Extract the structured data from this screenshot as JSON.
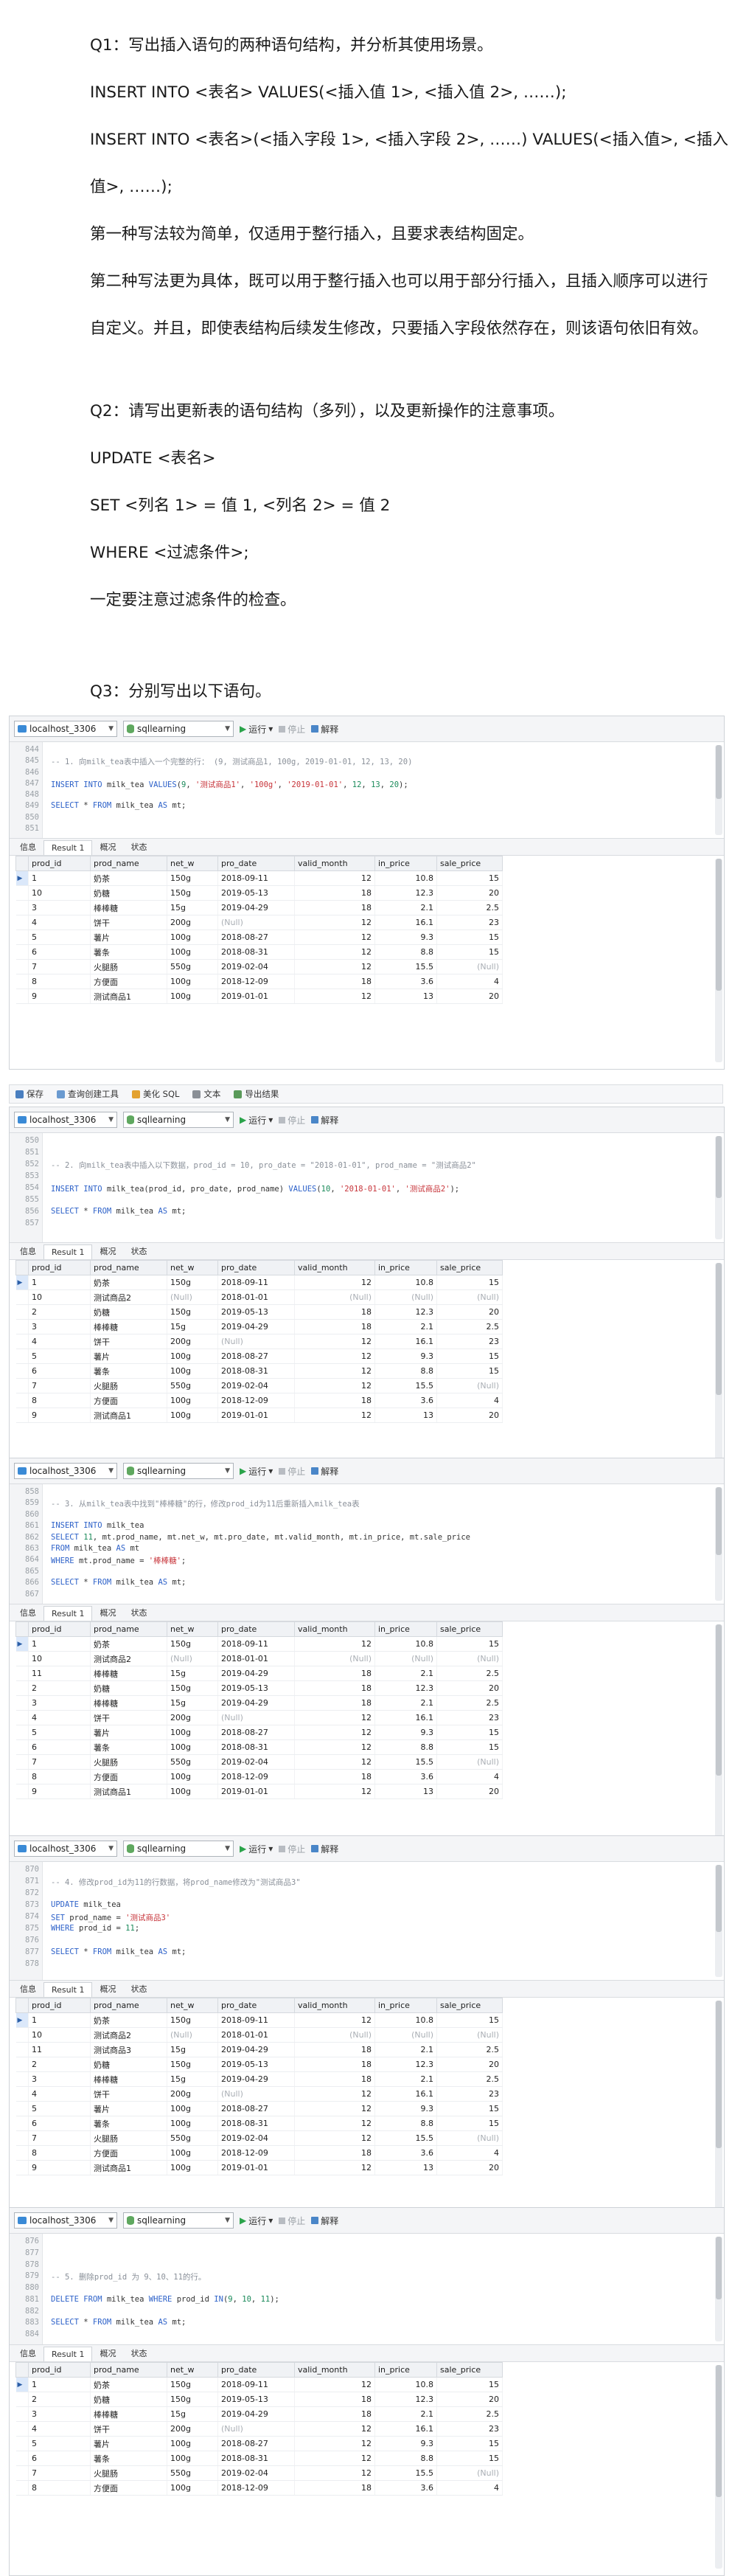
{
  "doc": {
    "q1_title": "Q1：写出插入语句的两种语句结构，并分析其使用场景。",
    "q1_syntax1": "INSERT INTO <表名> VALUES(<插入值 1>, <插入值 2>, ……);",
    "q1_syntax2a": "INSERT  INTO  <表名>(<插入字段  1>,  <插入字段  2>,  ……)  VALUES(<插入值>,  <插入",
    "q1_syntax2b": "值>, ……);",
    "q1_note1": "第一种写法较为简单，仅适用于整行插入，且要求表结构固定。",
    "q1_note2": "第二种写法更为具体，既可以用于整行插入也可以用于部分行插入，且插入顺序可以进行自定义。并且，即使表结构后续发生修改，只要插入字段依然存在，则该语句依旧有效。",
    "q2_title": "Q2：请写出更新表的语句结构（多列），以及更新操作的注意事项。",
    "q2_line1": "UPDATE <表名>",
    "q2_line2": "SET <列名 1> = 值 1, <列名 2> = 值 2",
    "q2_line3": "WHERE <过滤条件>;",
    "q2_note": "一定要注意过滤条件的检查。",
    "q3_title": "Q3：分别写出以下语句。"
  },
  "toolbar": {
    "connection": "localhost_3306",
    "database": "sqllearning",
    "run_label": "运行",
    "stop_label": "停止",
    "explain_label": "解释"
  },
  "main_toolbar": {
    "save": "保存",
    "query_builder": "查询创建工具",
    "beautify": "美化 SQL",
    "text": "文本",
    "export": "导出结果"
  },
  "result_tabs": [
    "信息",
    "Result 1",
    "概况",
    "状态"
  ],
  "columns": [
    "prod_id",
    "prod_name",
    "net_w",
    "pro_date",
    "valid_month",
    "in_price",
    "sale_price"
  ],
  "null_text": "(Null)",
  "shots": [
    {
      "line_numbers": [
        "844",
        "845",
        "846",
        "847",
        "848",
        "849",
        "850",
        "851"
      ],
      "code": [
        [],
        [
          {
            "t": "-- 1. 向milk_tea表中插入一个完整的行： (9, 测试商品1, 100g, 2019-01-01, 12, 13, 20)",
            "c": "cm"
          }
        ],
        [],
        [
          {
            "t": "INSERT INTO ",
            "c": "kw"
          },
          {
            "t": "milk_tea ",
            "c": ""
          },
          {
            "t": "VALUES",
            "c": "kw"
          },
          {
            "t": "(",
            "c": ""
          },
          {
            "t": "9",
            "c": "num"
          },
          {
            "t": ", ",
            "c": ""
          },
          {
            "t": "'测试商品1'",
            "c": "str"
          },
          {
            "t": ", ",
            "c": ""
          },
          {
            "t": "'100g'",
            "c": "str"
          },
          {
            "t": ", ",
            "c": ""
          },
          {
            "t": "'2019-01-01'",
            "c": "str"
          },
          {
            "t": ", ",
            "c": ""
          },
          {
            "t": "12",
            "c": "num"
          },
          {
            "t": ", ",
            "c": ""
          },
          {
            "t": "13",
            "c": "num"
          },
          {
            "t": ", ",
            "c": ""
          },
          {
            "t": "20",
            "c": "num"
          },
          {
            "t": ");",
            "c": ""
          }
        ],
        [],
        [
          {
            "t": "SELECT ",
            "c": "kw"
          },
          {
            "t": "* ",
            "c": ""
          },
          {
            "t": "FROM ",
            "c": "kw"
          },
          {
            "t": "milk_tea ",
            "c": ""
          },
          {
            "t": "AS ",
            "c": "kw"
          },
          {
            "t": "mt;",
            "c": ""
          }
        ],
        [],
        []
      ],
      "rows": [
        [
          "1",
          "奶茶",
          "150g",
          "2018-09-11",
          "12",
          "10.8",
          "15"
        ],
        [
          "10",
          "奶糖",
          "150g",
          "2019-05-13",
          "18",
          "12.3",
          "20"
        ],
        [
          "3",
          "棒棒糖",
          "15g",
          "2019-04-29",
          "18",
          "2.1",
          "2.5"
        ],
        [
          "4",
          "饼干",
          "200g",
          null,
          "12",
          "16.1",
          "23"
        ],
        [
          "5",
          "薯片",
          "100g",
          "2018-08-27",
          "12",
          "9.3",
          "15"
        ],
        [
          "6",
          "薯条",
          "100g",
          "2018-08-31",
          "12",
          "8.8",
          "15"
        ],
        [
          "7",
          "火腿肠",
          "550g",
          "2019-02-04",
          "12",
          "15.5",
          null
        ],
        [
          "8",
          "方便面",
          "100g",
          "2018-12-09",
          "18",
          "3.6",
          "4"
        ],
        [
          "9",
          "测试商品1",
          "100g",
          "2019-01-01",
          "12",
          "13",
          "20"
        ]
      ]
    },
    {
      "line_numbers": [
        "850",
        "851",
        "852",
        "853",
        "854",
        "855",
        "856",
        "857"
      ],
      "code": [
        [],
        [],
        [
          {
            "t": "-- 2. 向milk_tea表中插入以下数据，prod_id = 10, pro_date = \"2018-01-01\", prod_name = \"测试商品2\"",
            "c": "cm"
          }
        ],
        [],
        [
          {
            "t": "INSERT INTO ",
            "c": "kw"
          },
          {
            "t": "milk_tea(prod_id, pro_date, prod_name) ",
            "c": ""
          },
          {
            "t": "VALUES",
            "c": "kw"
          },
          {
            "t": "(",
            "c": ""
          },
          {
            "t": "10",
            "c": "num"
          },
          {
            "t": ", ",
            "c": ""
          },
          {
            "t": "'2018-01-01'",
            "c": "str"
          },
          {
            "t": ", ",
            "c": ""
          },
          {
            "t": "'测试商品2'",
            "c": "str"
          },
          {
            "t": ");",
            "c": ""
          }
        ],
        [],
        [
          {
            "t": "SELECT ",
            "c": "kw"
          },
          {
            "t": "* ",
            "c": ""
          },
          {
            "t": "FROM ",
            "c": "kw"
          },
          {
            "t": "milk_tea ",
            "c": ""
          },
          {
            "t": "AS ",
            "c": "kw"
          },
          {
            "t": "mt;",
            "c": ""
          }
        ],
        []
      ],
      "rows": [
        [
          "1",
          "奶茶",
          "150g",
          "2018-09-11",
          "12",
          "10.8",
          "15"
        ],
        [
          "10",
          "测试商品2",
          null,
          "2018-01-01",
          null,
          null,
          null
        ],
        [
          "2",
          "奶糖",
          "150g",
          "2019-05-13",
          "18",
          "12.3",
          "20"
        ],
        [
          "3",
          "棒棒糖",
          "15g",
          "2019-04-29",
          "18",
          "2.1",
          "2.5"
        ],
        [
          "4",
          "饼干",
          "200g",
          null,
          "12",
          "16.1",
          "23"
        ],
        [
          "5",
          "薯片",
          "100g",
          "2018-08-27",
          "12",
          "9.3",
          "15"
        ],
        [
          "6",
          "薯条",
          "100g",
          "2018-08-31",
          "12",
          "8.8",
          "15"
        ],
        [
          "7",
          "火腿肠",
          "550g",
          "2019-02-04",
          "12",
          "15.5",
          null
        ],
        [
          "8",
          "方便面",
          "100g",
          "2018-12-09",
          "18",
          "3.6",
          "4"
        ],
        [
          "9",
          "测试商品1",
          "100g",
          "2019-01-01",
          "12",
          "13",
          "20"
        ]
      ]
    },
    {
      "line_numbers": [
        "858",
        "859",
        "860",
        "861",
        "862",
        "863",
        "864",
        "865",
        "866",
        "867"
      ],
      "code": [
        [],
        [
          {
            "t": "-- 3. 从milk_tea表中找到\"棒棒糖\"的行，修改prod_id为11后重新插入milk_tea表",
            "c": "cm"
          }
        ],
        [],
        [
          {
            "t": "INSERT INTO ",
            "c": "kw"
          },
          {
            "t": "milk_tea",
            "c": ""
          }
        ],
        [
          {
            "t": "SELECT ",
            "c": "kw"
          },
          {
            "t": "11",
            "c": "num"
          },
          {
            "t": ", mt.prod_name, mt.net_w, mt.pro_date, mt.valid_month, mt.in_price, mt.sale_price",
            "c": ""
          }
        ],
        [
          {
            "t": "FROM ",
            "c": "kw"
          },
          {
            "t": "milk_tea ",
            "c": ""
          },
          {
            "t": "AS ",
            "c": "kw"
          },
          {
            "t": "mt",
            "c": ""
          }
        ],
        [
          {
            "t": "WHERE ",
            "c": "kw"
          },
          {
            "t": "mt.prod_name = ",
            "c": ""
          },
          {
            "t": "'棒棒糖'",
            "c": "str"
          },
          {
            "t": ";",
            "c": ""
          }
        ],
        [],
        [
          {
            "t": "SELECT ",
            "c": "kw"
          },
          {
            "t": "* ",
            "c": ""
          },
          {
            "t": "FROM ",
            "c": "kw"
          },
          {
            "t": "milk_tea ",
            "c": ""
          },
          {
            "t": "AS ",
            "c": "kw"
          },
          {
            "t": "mt;",
            "c": ""
          }
        ],
        []
      ],
      "rows": [
        [
          "1",
          "奶茶",
          "150g",
          "2018-09-11",
          "12",
          "10.8",
          "15"
        ],
        [
          "10",
          "测试商品2",
          null,
          "2018-01-01",
          null,
          null,
          null
        ],
        [
          "11",
          "棒棒糖",
          "15g",
          "2019-04-29",
          "18",
          "2.1",
          "2.5"
        ],
        [
          "2",
          "奶糖",
          "150g",
          "2019-05-13",
          "18",
          "12.3",
          "20"
        ],
        [
          "3",
          "棒棒糖",
          "15g",
          "2019-04-29",
          "18",
          "2.1",
          "2.5"
        ],
        [
          "4",
          "饼干",
          "200g",
          null,
          "12",
          "16.1",
          "23"
        ],
        [
          "5",
          "薯片",
          "100g",
          "2018-08-27",
          "12",
          "9.3",
          "15"
        ],
        [
          "6",
          "薯条",
          "100g",
          "2018-08-31",
          "12",
          "8.8",
          "15"
        ],
        [
          "7",
          "火腿肠",
          "550g",
          "2019-02-04",
          "12",
          "15.5",
          null
        ],
        [
          "8",
          "方便面",
          "100g",
          "2018-12-09",
          "18",
          "3.6",
          "4"
        ],
        [
          "9",
          "测试商品1",
          "100g",
          "2019-01-01",
          "12",
          "13",
          "20"
        ]
      ]
    },
    {
      "line_numbers": [
        "870",
        "871",
        "872",
        "873",
        "874",
        "875",
        "876",
        "877",
        "878"
      ],
      "code": [
        [],
        [
          {
            "t": "-- 4. 修改prod_id为11的行数据，将prod_name修改为\"测试商品3\"",
            "c": "cm"
          }
        ],
        [],
        [
          {
            "t": "UPDATE ",
            "c": "kw"
          },
          {
            "t": "milk_tea",
            "c": ""
          }
        ],
        [
          {
            "t": "SET ",
            "c": "kw"
          },
          {
            "t": "prod_name = ",
            "c": ""
          },
          {
            "t": "'测试商品3'",
            "c": "str"
          }
        ],
        [
          {
            "t": "WHERE ",
            "c": "kw"
          },
          {
            "t": "prod_id = ",
            "c": ""
          },
          {
            "t": "11",
            "c": "num"
          },
          {
            "t": ";",
            "c": ""
          }
        ],
        [],
        [
          {
            "t": "SELECT ",
            "c": "kw"
          },
          {
            "t": "* ",
            "c": ""
          },
          {
            "t": "FROM ",
            "c": "kw"
          },
          {
            "t": "milk_tea ",
            "c": ""
          },
          {
            "t": "AS ",
            "c": "kw"
          },
          {
            "t": "mt;",
            "c": ""
          }
        ],
        []
      ],
      "rows": [
        [
          "1",
          "奶茶",
          "150g",
          "2018-09-11",
          "12",
          "10.8",
          "15"
        ],
        [
          "10",
          "测试商品2",
          null,
          "2018-01-01",
          null,
          null,
          null
        ],
        [
          "11",
          "测试商品3",
          "15g",
          "2019-04-29",
          "18",
          "2.1",
          "2.5"
        ],
        [
          "2",
          "奶糖",
          "150g",
          "2019-05-13",
          "18",
          "12.3",
          "20"
        ],
        [
          "3",
          "棒棒糖",
          "15g",
          "2019-04-29",
          "18",
          "2.1",
          "2.5"
        ],
        [
          "4",
          "饼干",
          "200g",
          null,
          "12",
          "16.1",
          "23"
        ],
        [
          "5",
          "薯片",
          "100g",
          "2018-08-27",
          "12",
          "9.3",
          "15"
        ],
        [
          "6",
          "薯条",
          "100g",
          "2018-08-31",
          "12",
          "8.8",
          "15"
        ],
        [
          "7",
          "火腿肠",
          "550g",
          "2019-02-04",
          "12",
          "15.5",
          null
        ],
        [
          "8",
          "方便面",
          "100g",
          "2018-12-09",
          "18",
          "3.6",
          "4"
        ],
        [
          "9",
          "测试商品1",
          "100g",
          "2019-01-01",
          "12",
          "13",
          "20"
        ]
      ]
    },
    {
      "line_numbers": [
        "876",
        "877",
        "878",
        "879",
        "880",
        "881",
        "882",
        "883",
        "884"
      ],
      "code": [
        [],
        [],
        [],
        [
          {
            "t": "-- 5. 删除prod_id 为 9、10、11的行。",
            "c": "cm"
          }
        ],
        [],
        [
          {
            "t": "DELETE FROM ",
            "c": "kw"
          },
          {
            "t": "milk_tea ",
            "c": ""
          },
          {
            "t": "WHERE ",
            "c": "kw"
          },
          {
            "t": "prod_id ",
            "c": ""
          },
          {
            "t": "IN",
            "c": "kw"
          },
          {
            "t": "(",
            "c": ""
          },
          {
            "t": "9",
            "c": "num"
          },
          {
            "t": ", ",
            "c": ""
          },
          {
            "t": "10",
            "c": "num"
          },
          {
            "t": ", ",
            "c": ""
          },
          {
            "t": "11",
            "c": "num"
          },
          {
            "t": ");",
            "c": ""
          }
        ],
        [],
        [
          {
            "t": "SELECT ",
            "c": "kw"
          },
          {
            "t": "* ",
            "c": ""
          },
          {
            "t": "FROM ",
            "c": "kw"
          },
          {
            "t": "milk_tea ",
            "c": ""
          },
          {
            "t": "AS ",
            "c": "kw"
          },
          {
            "t": "mt;",
            "c": ""
          }
        ],
        []
      ],
      "rows": [
        [
          "1",
          "奶茶",
          "150g",
          "2018-09-11",
          "12",
          "10.8",
          "15"
        ],
        [
          "2",
          "奶糖",
          "150g",
          "2019-05-13",
          "18",
          "12.3",
          "20"
        ],
        [
          "3",
          "棒棒糖",
          "15g",
          "2019-04-29",
          "18",
          "2.1",
          "2.5"
        ],
        [
          "4",
          "饼干",
          "200g",
          null,
          "12",
          "16.1",
          "23"
        ],
        [
          "5",
          "薯片",
          "100g",
          "2018-08-27",
          "12",
          "9.3",
          "15"
        ],
        [
          "6",
          "薯条",
          "100g",
          "2018-08-31",
          "12",
          "8.8",
          "15"
        ],
        [
          "7",
          "火腿肠",
          "550g",
          "2019-02-04",
          "12",
          "15.5",
          null
        ],
        [
          "8",
          "方便面",
          "100g",
          "2018-12-09",
          "18",
          "3.6",
          "4"
        ]
      ]
    }
  ]
}
